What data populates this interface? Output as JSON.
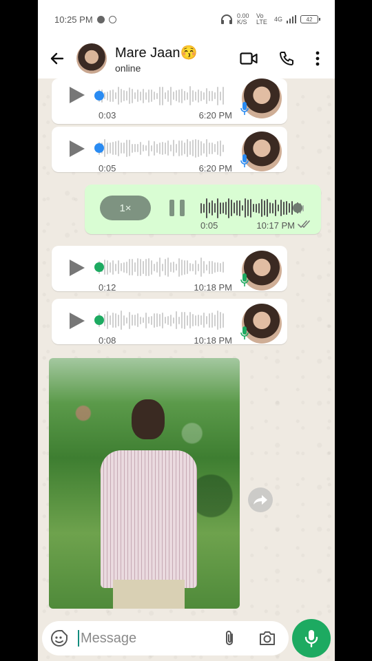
{
  "status_bar": {
    "time": "10:25 PM",
    "network_speed": "0.00 K/S",
    "network_type": "Vo LTE",
    "signal": "4G",
    "battery": "42"
  },
  "header": {
    "contact_name": "Mare Jaan😚",
    "contact_status": "online"
  },
  "messages": [
    {
      "type": "voice",
      "direction": "in",
      "duration": "0:03",
      "time": "6:20 PM",
      "mic_color": "#2a8bf2",
      "dot_color": "#2a8bf2"
    },
    {
      "type": "voice",
      "direction": "in",
      "duration": "0:05",
      "time": "6:20 PM",
      "mic_color": "#2a8bf2",
      "dot_color": "#2a8bf2"
    },
    {
      "type": "voice",
      "direction": "out",
      "speed": "1×",
      "duration": "0:05",
      "time": "10:17 PM",
      "progress": 0.93
    },
    {
      "type": "voice",
      "direction": "in",
      "duration": "0:12",
      "time": "10:18 PM",
      "mic_color": "#1daa61",
      "dot_color": "#1daa61"
    },
    {
      "type": "voice",
      "direction": "in",
      "duration": "0:08",
      "time": "10:18 PM",
      "mic_color": "#1daa61",
      "dot_color": "#1daa61"
    },
    {
      "type": "image",
      "direction": "in"
    }
  ],
  "composer": {
    "placeholder": "Message"
  },
  "colors": {
    "accent": "#1daa61",
    "outgoing_bubble": "#d9fdd3",
    "chat_background": "#efeae2"
  }
}
